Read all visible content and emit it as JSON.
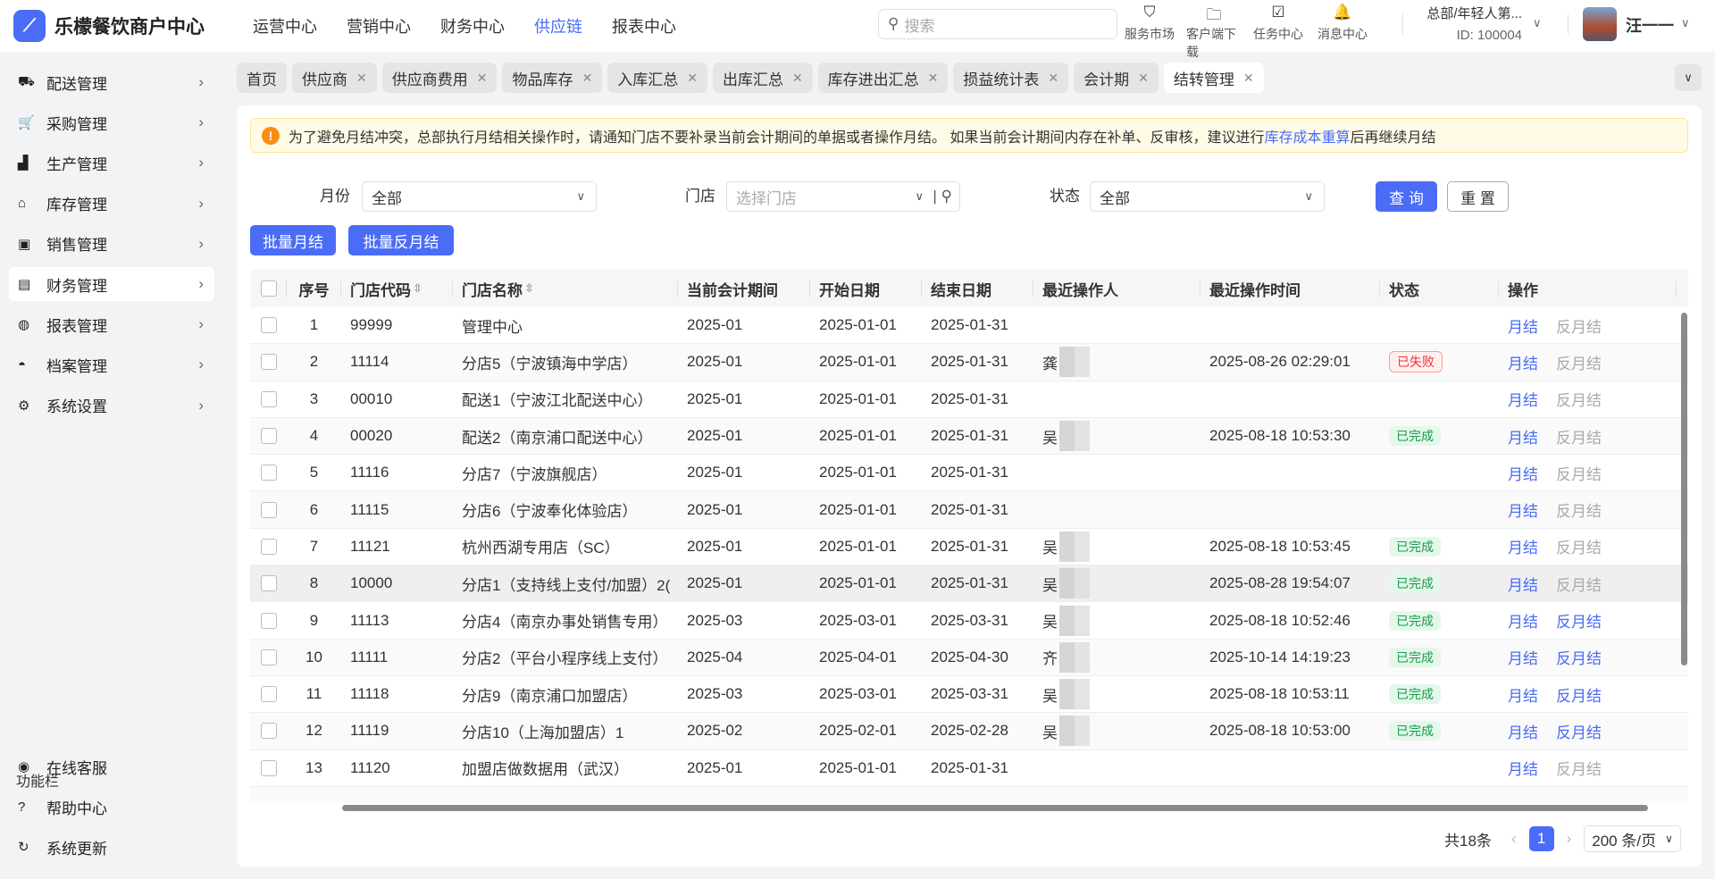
{
  "app": {
    "title": "乐檬餐饮商户中心",
    "brand_color": "#4a6cf7"
  },
  "topnav": [
    "运营中心",
    "营销中心",
    "财务中心",
    "供应链",
    "报表中心"
  ],
  "topnav_active": 3,
  "search": {
    "placeholder": "搜索"
  },
  "tools": [
    {
      "icon": "market-icon",
      "label": "服务市场"
    },
    {
      "icon": "download-folder-icon",
      "label": "客户端下载"
    },
    {
      "icon": "clipboard-check-icon",
      "label": "任务中心"
    },
    {
      "icon": "bell-icon",
      "label": "消息中心"
    }
  ],
  "org": {
    "name": "总部/年轻人第...",
    "id": "ID: 100004"
  },
  "user": {
    "name": "汪一一"
  },
  "sidebar": {
    "items": [
      {
        "icon": "truck-icon",
        "label": "配送管理"
      },
      {
        "icon": "cart-icon",
        "label": "采购管理"
      },
      {
        "icon": "factory-icon",
        "label": "生产管理"
      },
      {
        "icon": "warehouse-icon",
        "label": "库存管理"
      },
      {
        "icon": "bag-icon",
        "label": "销售管理"
      },
      {
        "icon": "finance-icon",
        "label": "财务管理"
      },
      {
        "icon": "globe-icon",
        "label": "报表管理"
      },
      {
        "icon": "archive-icon",
        "label": "档案管理"
      },
      {
        "icon": "gear-icon",
        "label": "系统设置"
      }
    ],
    "active": 5,
    "function_title": "功能栏",
    "functions": [
      {
        "icon": "headset-icon",
        "label": "在线客服"
      },
      {
        "icon": "help-icon",
        "label": "帮助中心"
      },
      {
        "icon": "refresh-icon",
        "label": "系统更新"
      }
    ]
  },
  "tabs": [
    {
      "label": "首页",
      "closable": false
    },
    {
      "label": "供应商",
      "closable": true
    },
    {
      "label": "供应商费用",
      "closable": true
    },
    {
      "label": "物品库存",
      "closable": true
    },
    {
      "label": "入库汇总",
      "closable": true
    },
    {
      "label": "出库汇总",
      "closable": true
    },
    {
      "label": "库存进出汇总",
      "closable": true
    },
    {
      "label": "损益统计表",
      "closable": true
    },
    {
      "label": "会计期",
      "closable": true
    },
    {
      "label": "结转管理",
      "closable": true
    }
  ],
  "active_tab": 9,
  "alert": {
    "text_before": "为了避免月结冲突，总部执行月结相关操作时，请通知门店不要补录当前会计期间的单据或者操作月结。 如果当前会计期间内存在补单、反审核，建议进行",
    "link": "库存成本重算",
    "text_after": "后再继续月结"
  },
  "filters": {
    "month_label": "月份",
    "month_value": "全部",
    "store_label": "门店",
    "store_placeholder": "选择门店",
    "status_label": "状态",
    "status_value": "全部",
    "query": "查 询",
    "reset": "重 置"
  },
  "batch": {
    "close": "批量月结",
    "reverse": "批量反月结"
  },
  "table": {
    "columns": [
      "序号",
      "门店代码",
      "门店名称",
      "当前会计期间",
      "开始日期",
      "结束日期",
      "最近操作人",
      "最近操作时间",
      "状态",
      "操作"
    ],
    "op_close": "月结",
    "op_reverse": "反月结",
    "rows": [
      {
        "no": "1",
        "code": "99999",
        "name": "管理中心",
        "period": "2025-01",
        "start": "2025-01-01",
        "end": "2025-01-31",
        "operator": "",
        "time": "",
        "status": "",
        "reverse_enabled": false
      },
      {
        "no": "2",
        "code": "11114",
        "name": "分店5（宁波镇海中学店）",
        "period": "2025-01",
        "start": "2025-01-01",
        "end": "2025-01-31",
        "operator": "龚",
        "time": "2025-08-26 02:29:01",
        "status": "已失败",
        "reverse_enabled": false
      },
      {
        "no": "3",
        "code": "00010",
        "name": "配送1（宁波江北配送中心）",
        "period": "2025-01",
        "start": "2025-01-01",
        "end": "2025-01-31",
        "operator": "",
        "time": "",
        "status": "",
        "reverse_enabled": false
      },
      {
        "no": "4",
        "code": "00020",
        "name": "配送2（南京浦口配送中心）",
        "period": "2025-01",
        "start": "2025-01-01",
        "end": "2025-01-31",
        "operator": "吴",
        "time": "2025-08-18 10:53:30",
        "status": "已完成",
        "reverse_enabled": false
      },
      {
        "no": "5",
        "code": "11116",
        "name": "分店7（宁波旗舰店）",
        "period": "2025-01",
        "start": "2025-01-01",
        "end": "2025-01-31",
        "operator": "",
        "time": "",
        "status": "",
        "reverse_enabled": false
      },
      {
        "no": "6",
        "code": "11115",
        "name": "分店6（宁波奉化体验店）",
        "period": "2025-01",
        "start": "2025-01-01",
        "end": "2025-01-31",
        "operator": "",
        "time": "",
        "status": "",
        "reverse_enabled": false
      },
      {
        "no": "7",
        "code": "11121",
        "name": "杭州西湖专用店（SC）",
        "period": "2025-01",
        "start": "2025-01-01",
        "end": "2025-01-31",
        "operator": "吴",
        "time": "2025-08-18 10:53:45",
        "status": "已完成",
        "reverse_enabled": false
      },
      {
        "no": "8",
        "code": "10000",
        "name": "分店1（支持线上支付/加盟）2(",
        "period": "2025-01",
        "start": "2025-01-01",
        "end": "2025-01-31",
        "operator": "吴",
        "time": "2025-08-28 19:54:07",
        "status": "已完成",
        "reverse_enabled": false
      },
      {
        "no": "9",
        "code": "11113",
        "name": "分店4（南京办事处销售专用）",
        "period": "2025-03",
        "start": "2025-03-01",
        "end": "2025-03-31",
        "operator": "吴",
        "time": "2025-08-18 10:52:46",
        "status": "已完成",
        "reverse_enabled": true
      },
      {
        "no": "10",
        "code": "11111",
        "name": "分店2（平台小程序线上支付）",
        "period": "2025-04",
        "start": "2025-04-01",
        "end": "2025-04-30",
        "operator": "齐",
        "time": "2025-10-14 14:19:23",
        "status": "已完成",
        "reverse_enabled": true
      },
      {
        "no": "11",
        "code": "11118",
        "name": "分店9（南京浦口加盟店）",
        "period": "2025-03",
        "start": "2025-03-01",
        "end": "2025-03-31",
        "operator": "吴",
        "time": "2025-08-18 10:53:11",
        "status": "已完成",
        "reverse_enabled": true
      },
      {
        "no": "12",
        "code": "11119",
        "name": "分店10（上海加盟店）1",
        "period": "2025-02",
        "start": "2025-02-01",
        "end": "2025-02-28",
        "operator": "吴",
        "time": "2025-08-18 10:53:00",
        "status": "已完成",
        "reverse_enabled": true
      },
      {
        "no": "13",
        "code": "11120",
        "name": "加盟店做数据用（武汉）",
        "period": "2025-01",
        "start": "2025-01-01",
        "end": "2025-01-31",
        "operator": "",
        "time": "",
        "status": "",
        "reverse_enabled": false
      }
    ]
  },
  "pagination": {
    "total": "共18条",
    "current": "1",
    "page_size": "200 条/页"
  }
}
